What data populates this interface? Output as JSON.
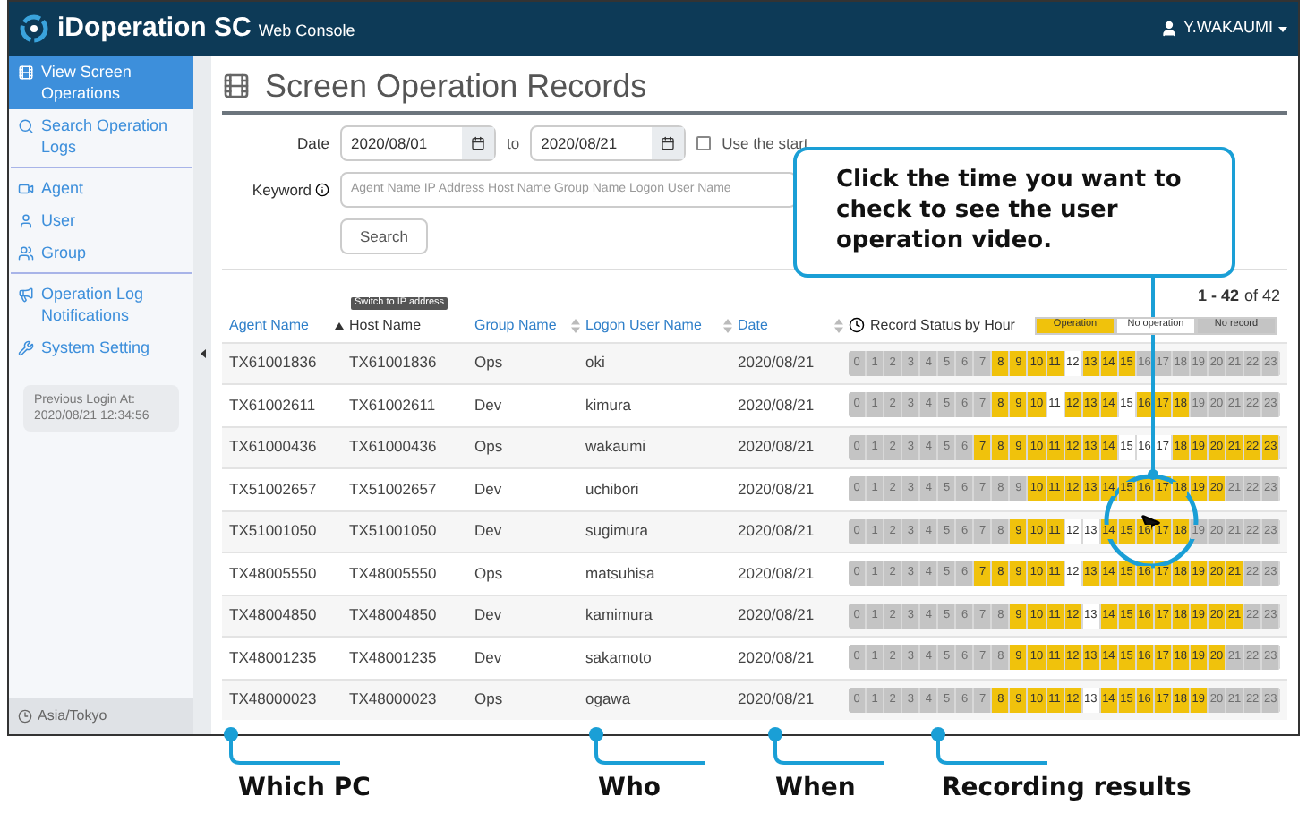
{
  "header": {
    "brand": "iDoperation SC",
    "subtitle": "Web Console",
    "user": "Y.WAKAUMI"
  },
  "sidebar": {
    "items": [
      {
        "label": "View Screen Operations",
        "selected": true,
        "divider_after": false
      },
      {
        "label": "Search Operation Logs",
        "selected": false,
        "divider_after": true
      },
      {
        "label": "Agent",
        "selected": false,
        "divider_after": false
      },
      {
        "label": "User",
        "selected": false,
        "divider_after": false
      },
      {
        "label": "Group",
        "selected": false,
        "divider_after": true
      },
      {
        "label": "Operation Log Notifications",
        "selected": false,
        "divider_after": false
      },
      {
        "label": "System Setting",
        "selected": false,
        "divider_after": false
      }
    ],
    "login_label": "Previous Login At:",
    "login_time": "2020/08/21 12:34:56",
    "timezone": "Asia/Tokyo"
  },
  "page": {
    "title": "Screen Operation Records",
    "form": {
      "date_label": "Date",
      "date_from": "2020/08/01",
      "to_label": "to",
      "date_to": "2020/08/21",
      "checkbox_label": "Use the start",
      "checked": false,
      "keyword_label": "Keyword",
      "keyword_placeholder": "Agent Name IP Address Host Name Group Name Logon User Name",
      "search_button": "Search"
    },
    "count": {
      "range": "1 - 42",
      "of": "of 42"
    },
    "tooltip": "Switch to IP address",
    "legend": [
      {
        "label": "Operation",
        "kind": "operation"
      },
      {
        "label": "No operation",
        "kind": "idle"
      },
      {
        "label": "No record",
        "kind": "none"
      }
    ],
    "table": {
      "columns": [
        {
          "label": "Agent Name",
          "link": true,
          "sortable": true,
          "sorted": true
        },
        {
          "label": "Host Name",
          "link": false,
          "sortable": false,
          "sorted": false
        },
        {
          "label": "Group Name",
          "link": true,
          "sortable": true,
          "sorted": false
        },
        {
          "label": "Logon User Name",
          "link": true,
          "sortable": true,
          "sorted": false
        },
        {
          "label": "Date",
          "link": true,
          "sortable": true,
          "sorted": false
        },
        {
          "label": "Record Status by Hour",
          "link": false,
          "sortable": false,
          "sorted": false
        }
      ],
      "rows": [
        {
          "agent": "TX61001836",
          "host": "TX61001836",
          "group": "Ops",
          "user": "oki",
          "date": "2020/08/21",
          "hours": [
            {
              "kind": "none",
              "labels": [
                "0",
                "1",
                "2",
                "3",
                "4",
                "5",
                "6",
                "7"
              ]
            },
            {
              "kind": "operation",
              "labels": [
                "8",
                "9",
                "10",
                "11"
              ]
            },
            {
              "kind": "idle",
              "labels": [
                "12"
              ]
            },
            {
              "kind": "operation",
              "labels": [
                "13",
                "14",
                "15"
              ]
            },
            {
              "kind": "none",
              "labels": [
                "16",
                "17",
                "18",
                "19",
                "20",
                "21",
                "22",
                "23"
              ]
            }
          ]
        },
        {
          "agent": "TX61002611",
          "host": "TX61002611",
          "group": "Dev",
          "user": "kimura",
          "date": "2020/08/21",
          "hours": [
            {
              "kind": "none",
              "labels": [
                "0",
                "1",
                "2",
                "3",
                "4",
                "5",
                "6",
                "7"
              ]
            },
            {
              "kind": "operation",
              "labels": [
                "8",
                "9",
                "10"
              ]
            },
            {
              "kind": "idle",
              "labels": [
                "11"
              ]
            },
            {
              "kind": "operation",
              "labels": [
                "12",
                "13",
                "14"
              ]
            },
            {
              "kind": "idle",
              "labels": [
                "15"
              ]
            },
            {
              "kind": "operation",
              "labels": [
                "16",
                "17",
                "18"
              ]
            },
            {
              "kind": "none",
              "labels": [
                "19",
                "20",
                "21",
                "22",
                "23"
              ]
            }
          ]
        },
        {
          "agent": "TX61000436",
          "host": "TX61000436",
          "group": "Ops",
          "user": "wakaumi",
          "date": "2020/08/21",
          "hours": [
            {
              "kind": "none",
              "labels": [
                "0",
                "1",
                "2",
                "3",
                "4",
                "5",
                "6"
              ]
            },
            {
              "kind": "operation",
              "labels": [
                "7",
                "8",
                "9",
                "10",
                "11",
                "12",
                "13",
                "14"
              ]
            },
            {
              "kind": "idle",
              "labels": [
                "15",
                "16",
                "17"
              ]
            },
            {
              "kind": "operation",
              "labels": [
                "18",
                "19",
                "20",
                "21",
                "22",
                "23"
              ]
            }
          ]
        },
        {
          "agent": "TX51002657",
          "host": "TX51002657",
          "group": "Dev",
          "user": "uchibori",
          "date": "2020/08/21",
          "hours": [
            {
              "kind": "none",
              "labels": [
                "0",
                "1",
                "2",
                "3",
                "4",
                "5",
                "6",
                "7",
                "8",
                "9"
              ]
            },
            {
              "kind": "operation",
              "labels": [
                "10",
                "11",
                "12",
                "13",
                "14",
                "15",
                "16",
                "17",
                "18",
                "19",
                "20"
              ]
            },
            {
              "kind": "none",
              "labels": [
                "21",
                "22",
                "23"
              ]
            }
          ]
        },
        {
          "agent": "TX51001050",
          "host": "TX51001050",
          "group": "Dev",
          "user": "sugimura",
          "date": "2020/08/21",
          "hours": [
            {
              "kind": "none",
              "labels": [
                "0",
                "1",
                "2",
                "3",
                "4",
                "5",
                "6",
                "7",
                "8"
              ]
            },
            {
              "kind": "operation",
              "labels": [
                "9",
                "10",
                "11"
              ]
            },
            {
              "kind": "idle",
              "labels": [
                "12",
                "13"
              ]
            },
            {
              "kind": "operation",
              "labels": [
                "14",
                "15",
                "16",
                "17",
                "18"
              ]
            },
            {
              "kind": "none",
              "labels": [
                "19",
                "20",
                "21",
                "22",
                "23"
              ]
            }
          ]
        },
        {
          "agent": "TX48005550",
          "host": "TX48005550",
          "group": "Ops",
          "user": "matsuhisa",
          "date": "2020/08/21",
          "hours": [
            {
              "kind": "none",
              "labels": [
                "0",
                "1",
                "2",
                "3",
                "4",
                "5",
                "6"
              ]
            },
            {
              "kind": "operation",
              "labels": [
                "7",
                "8",
                "9",
                "10",
                "11"
              ]
            },
            {
              "kind": "idle",
              "labels": [
                "12"
              ]
            },
            {
              "kind": "operation",
              "labels": [
                "13",
                "14",
                "15",
                "16",
                "17",
                "18",
                "19",
                "20",
                "21"
              ]
            },
            {
              "kind": "none",
              "labels": [
                "22",
                "23"
              ]
            }
          ]
        },
        {
          "agent": "TX48004850",
          "host": "TX48004850",
          "group": "Dev",
          "user": "kamimura",
          "date": "2020/08/21",
          "hours": [
            {
              "kind": "none",
              "labels": [
                "0",
                "1",
                "2",
                "3",
                "4",
                "5",
                "6",
                "7",
                "8"
              ]
            },
            {
              "kind": "operation",
              "labels": [
                "9",
                "10",
                "11",
                "12"
              ]
            },
            {
              "kind": "idle",
              "labels": [
                "13"
              ]
            },
            {
              "kind": "operation",
              "labels": [
                "14",
                "15",
                "16",
                "17",
                "18",
                "19",
                "20",
                "21"
              ]
            },
            {
              "kind": "none",
              "labels": [
                "22",
                "23"
              ]
            }
          ]
        },
        {
          "agent": "TX48001235",
          "host": "TX48001235",
          "group": "Dev",
          "user": "sakamoto",
          "date": "2020/08/21",
          "hours": [
            {
              "kind": "none",
              "labels": [
                "0",
                "1",
                "2",
                "3",
                "4",
                "5",
                "6",
                "7",
                "8"
              ]
            },
            {
              "kind": "operation",
              "labels": [
                "9",
                "10",
                "11",
                "12",
                "13",
                "14",
                "15",
                "16",
                "17",
                "18",
                "19",
                "20"
              ]
            },
            {
              "kind": "none",
              "labels": [
                "21",
                "22",
                "23"
              ]
            }
          ]
        },
        {
          "agent": "TX48000023",
          "host": "TX48000023",
          "group": "Ops",
          "user": "ogawa",
          "date": "2020/08/21",
          "hours": [
            {
              "kind": "none",
              "labels": [
                "0",
                "1",
                "2",
                "3",
                "4",
                "5",
                "6",
                "7"
              ]
            },
            {
              "kind": "operation",
              "labels": [
                "8",
                "9",
                "10",
                "11",
                "12"
              ]
            },
            {
              "kind": "idle",
              "labels": [
                "13"
              ]
            },
            {
              "kind": "operation",
              "labels": [
                "14",
                "15",
                "16",
                "17",
                "18",
                "19"
              ]
            },
            {
              "kind": "none",
              "labels": [
                "20",
                "21",
                "22",
                "23"
              ]
            }
          ]
        }
      ]
    }
  },
  "annotations": {
    "callout": "Click the time you want to check to see the user operation video.",
    "labels": [
      "Which PC",
      "Who",
      "When",
      "Recording results"
    ]
  }
}
